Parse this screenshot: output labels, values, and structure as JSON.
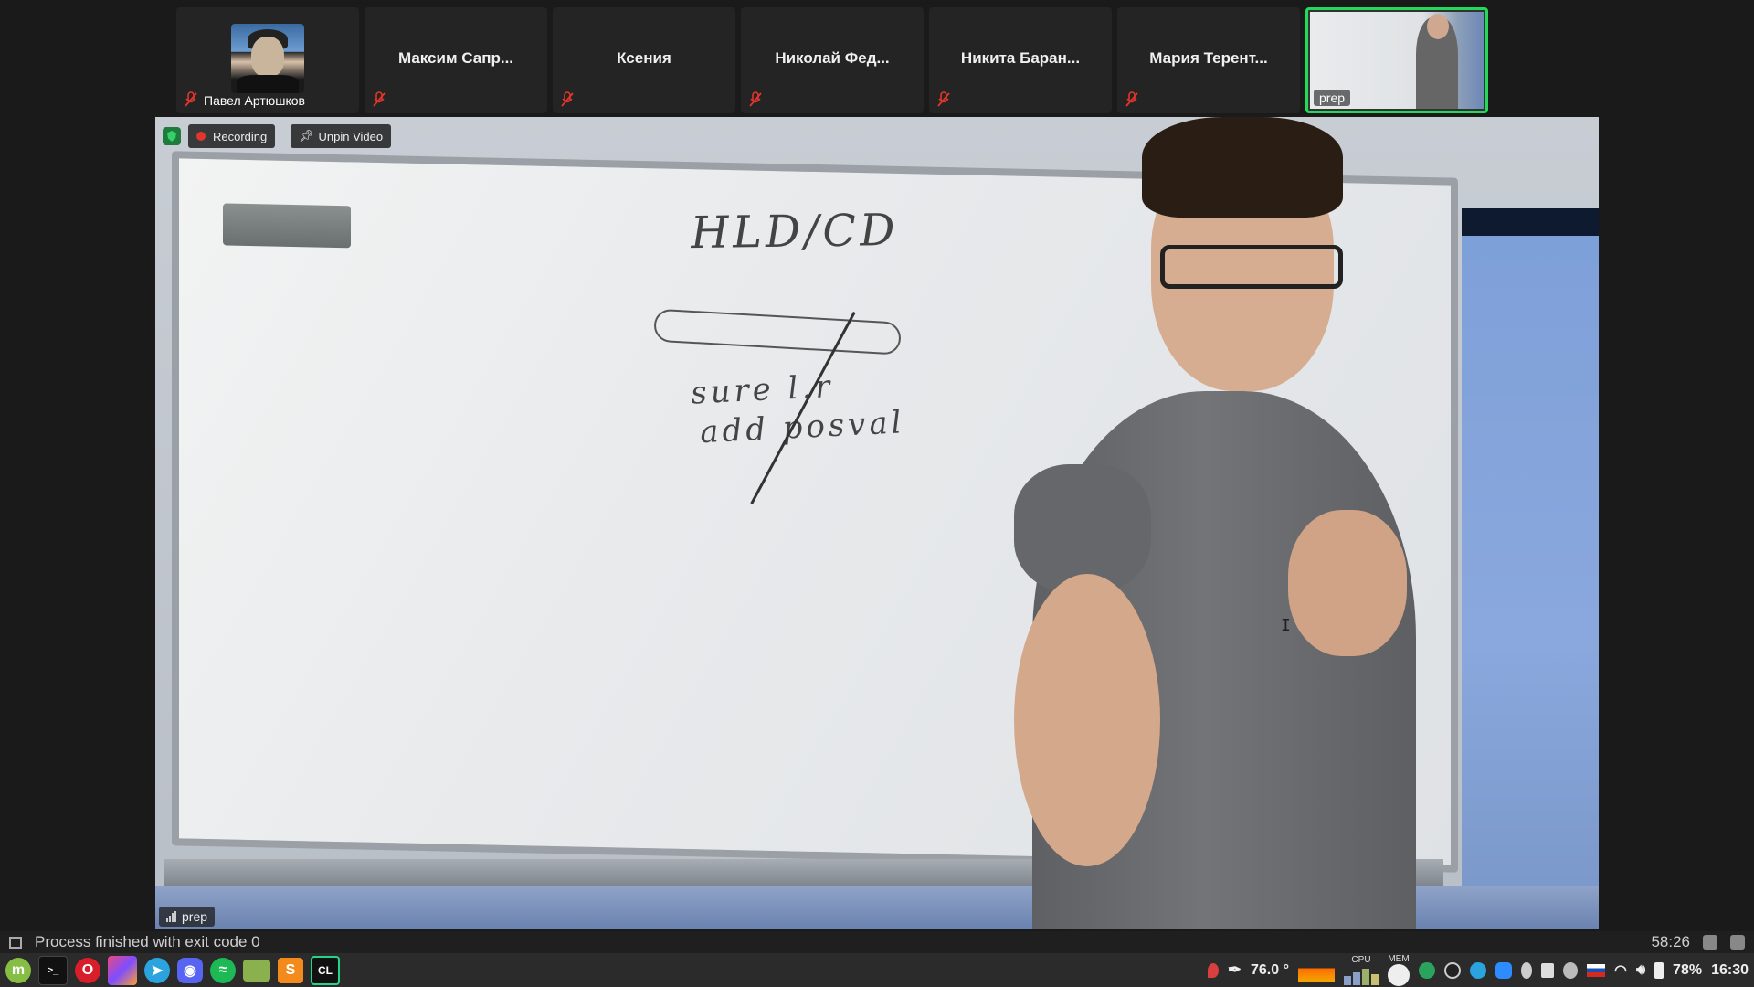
{
  "participants": [
    {
      "name": "Павел Артюшков",
      "muted": true
    },
    {
      "name": "Максим Сапр...",
      "muted": true
    },
    {
      "name": "Ксения",
      "muted": true
    },
    {
      "name": "Николай Фед...",
      "muted": true
    },
    {
      "name": "Никита Баран...",
      "muted": true
    },
    {
      "name": "Мария Терент...",
      "muted": true
    },
    {
      "name": "prep",
      "active_speaker": true
    }
  ],
  "video": {
    "recording_label": "Recording",
    "unpin_label": "Unpin Video",
    "pinned_name": "prep",
    "board_title": "HLD/CD",
    "board_line1": "sure l.r",
    "board_line2": "add posval"
  },
  "statusbar": {
    "message": "Process finished with exit code 0",
    "time": "58:26"
  },
  "taskbar": {
    "apps": [
      "linux-mint-menu-icon",
      "terminal-icon",
      "opera-icon",
      "jetbrains-toolbox-icon",
      "telegram-icon",
      "discord-icon",
      "spotify-icon",
      "files-icon",
      "sublime-text-icon",
      "clion-icon"
    ],
    "temperature": "76.0 °",
    "cpu_label": "CPU",
    "mem_label": "MEM",
    "battery": "78%",
    "clock": "16:30"
  },
  "colors": {
    "active_speaker_border": "#23d959",
    "recording_dot": "#e0362b",
    "muted_icon": "#e0362b"
  }
}
